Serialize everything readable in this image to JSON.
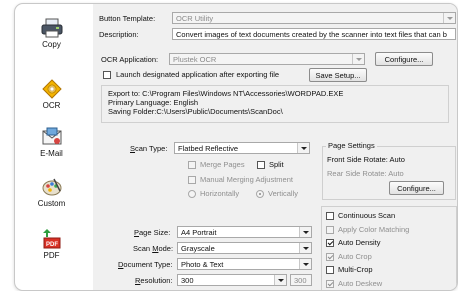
{
  "sidebar": {
    "items": [
      {
        "label": "Copy",
        "icon": "printer-icon"
      },
      {
        "label": "OCR",
        "icon": "ocr-icon"
      },
      {
        "label": "E-Mail",
        "icon": "email-icon"
      },
      {
        "label": "Custom",
        "icon": "custom-palette-icon"
      },
      {
        "label": "PDF",
        "icon": "pdf-icon"
      }
    ]
  },
  "template": {
    "label": "Button Template:",
    "value": "OCR Utility"
  },
  "description": {
    "label": "Description:",
    "value": "Convert images of text documents created by the scanner into text files that can b"
  },
  "ocr_app": {
    "label": "OCR Application:",
    "value": "Plustek OCR",
    "configure": "Configure..."
  },
  "launch": {
    "label": "Launch designated application after exporting file",
    "checked": false,
    "save_setup": "Save Setup..."
  },
  "info": {
    "line1": "Export to: C:\\Program Files\\Windows NT\\Accessories\\WORDPAD.EXE",
    "line2": "Primary Language: English",
    "line3": "Saving Folder:C:\\Users\\Public\\Documents\\ScanDoc\\"
  },
  "scan_type": {
    "label_pre": "S",
    "label_post": "can Type:",
    "value": "Flatbed Reflective"
  },
  "merge": {
    "merge_pages": "Merge Pages",
    "split": "Split",
    "manual_merge": "Manual Merging Adjustment",
    "horizontally": "Horizontally",
    "vertically": "Vertically"
  },
  "page_settings": {
    "title": "Page Settings",
    "front": "Front Side Rotate: Auto",
    "rear": "Rear Side Rotate: Auto",
    "configure": "Configure..."
  },
  "page_size": {
    "label_pre": "P",
    "label_post": "age Size:",
    "value": "A4 Portrait"
  },
  "scan_mode": {
    "label_pre": "Scan ",
    "label_u": "M",
    "label_post": "ode:",
    "value": "Grayscale"
  },
  "doc_type": {
    "label_pre": "D",
    "label_post": "ocument Type:",
    "value": "Photo & Text"
  },
  "resolution": {
    "label_pre": "R",
    "label_post": "esolution:",
    "value": "300",
    "value2": "300"
  },
  "options": [
    {
      "label": "Continuous Scan",
      "checked": false,
      "disabled": false
    },
    {
      "label": "Apply Color Matching",
      "checked": false,
      "disabled": true
    },
    {
      "label": "Auto Density",
      "checked": true,
      "disabled": false
    },
    {
      "label": "Auto Crop",
      "checked": true,
      "disabled": true
    },
    {
      "label": "Multi-Crop",
      "checked": false,
      "disabled": false
    },
    {
      "label": "Auto Deskew",
      "checked": true,
      "disabled": true
    }
  ]
}
